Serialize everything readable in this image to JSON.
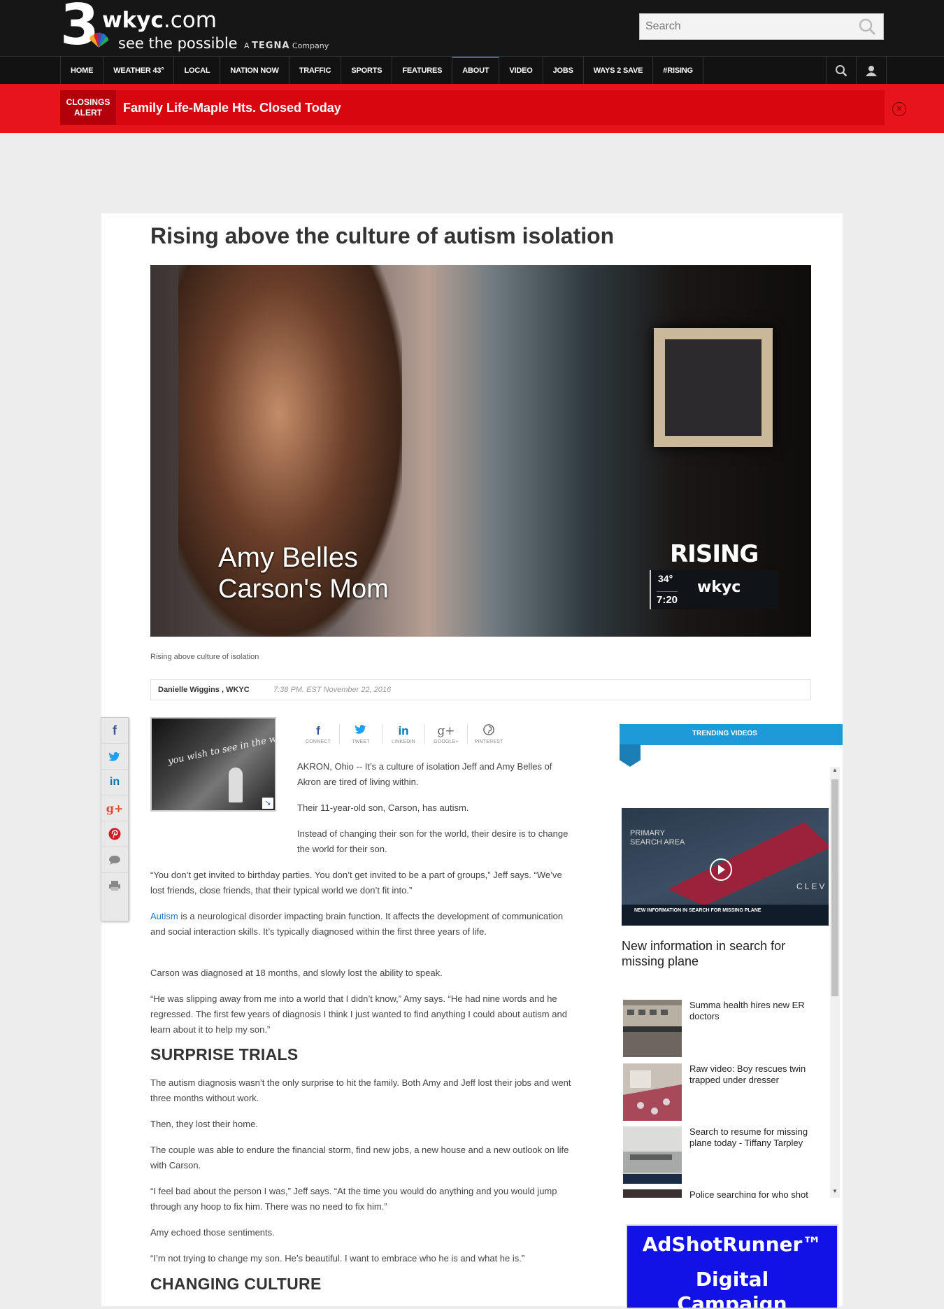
{
  "header": {
    "logo_number": "3",
    "logo_site": "wkyc",
    "logo_domain": ".com",
    "logo_tagline": "see the possible",
    "logo_tegna_prefix": "A",
    "logo_tegna": "TEGNA",
    "logo_tegna_suffix": "Company",
    "search_placeholder": "Search"
  },
  "nav": {
    "items": [
      "HOME",
      "WEATHER 43°",
      "LOCAL",
      "NATION NOW",
      "TRAFFIC",
      "SPORTS",
      "FEATURES",
      "ABOUT",
      "VIDEO",
      "JOBS",
      "WAYS 2 SAVE",
      "#RISING"
    ]
  },
  "alert": {
    "badge_line1": "CLOSINGS",
    "badge_line2": "ALERT",
    "text": "Family Life-Maple Hts. Closed Today"
  },
  "article": {
    "headline": "Rising above the culture of autism isolation",
    "video": {
      "name": "Amy Belles",
      "role": "Carson's Mom",
      "brand_rising": "RISING",
      "temp": "34°",
      "time": "7:20",
      "brand": "wkyc"
    },
    "caption": "Rising above culture of isolation",
    "author": "Danielle Wiggins , WKYC",
    "date": "7:38 PM. EST November 22, 2016",
    "thumb_text": "you wish to see in the world - Mahatma Gandhi",
    "share": [
      {
        "icon": "f",
        "label": "CONNECT",
        "color": "#3b5998"
      },
      {
        "icon": "t",
        "label": "TWEET",
        "color": "#1da1f2"
      },
      {
        "icon": "in",
        "label": "LINKEDIN",
        "color": "#0077b5"
      },
      {
        "icon": "g+",
        "label": "GOOGLE+",
        "color": "#666666"
      },
      {
        "icon": "p",
        "label": "PINTEREST",
        "color": "#666666"
      }
    ],
    "paragraphs": {
      "p1": "AKRON, Ohio -- It’s a culture of isolation Jeff and Amy Belles of Akron are tired of living within.",
      "p2": "Their 11-year-old son, Carson, has autism.",
      "p3": "Instead of changing their son for the world, their desire is to change the world for their son.",
      "p4": "“You don’t get invited to birthday parties. You don’t get invited to be a part of groups,” Jeff says. “We’ve lost friends, close friends, that their typical world we don’t fit into.”",
      "p5_link": "Autism",
      "p5_rest": " is a neurological disorder impacting brain function. It affects the development of communication and social interaction skills. It’s typically diagnosed within the first three years of life.",
      "p6": "Carson was diagnosed at 18 months, and slowly lost the ability to speak.",
      "p7": "“He was slipping away from me into a world that I didn’t know,” Amy says. “He had nine words and he regressed. The first few years of diagnosis I think I just wanted to find anything I could about autism and learn about it to help my son.”",
      "sub1": "SURPRISE TRIALS",
      "p8": "The autism diagnosis wasn’t the only surprise to hit the family. Both Amy and Jeff lost their jobs and went three months without work.",
      "p9": "Then, they lost their home.",
      "p10": "The couple was able to endure the financial storm, find new jobs, a new house and a new outlook on life with Carson.",
      "p11": "“I feel bad about the person I was,” Jeff says. “At the time you would do anything and you would jump through any hoop to fix him. There was no need to fix him.”",
      "p12": "Amy echoed those sentiments.",
      "p13": "“I’m not trying to change my son. He’s beautiful. I want to embrace who he is and what he is.”",
      "sub2": "CHANGING CULTURE"
    }
  },
  "sidebar": {
    "trending_title": "TRENDING VIDEOS",
    "featured": {
      "title": "New information in search for missing plane",
      "img_label_1": "PRIMARY",
      "img_label_2": "SEARCH AREA",
      "img_city": "CLEV",
      "img_strip": "NEW INFORMATION IN SEARCH FOR MISSING PLANE"
    },
    "videos": [
      {
        "title": "Summa health hires new ER doctors"
      },
      {
        "title": "Raw video: Boy rescues twin trapped under dresser"
      },
      {
        "title": "Search to resume for missing plane today - Tiffany Tarpley"
      },
      {
        "title": "Police searching for who shot"
      }
    ]
  },
  "ad": {
    "line1": "AdShotRunner™",
    "line2": "Digital",
    "line3": "Campaign"
  },
  "colors": {
    "alert_red": "#e8141b",
    "link_blue": "#2a7ac7",
    "trending_blue": "#1f9ad9",
    "ad_blue": "#1212e6"
  }
}
